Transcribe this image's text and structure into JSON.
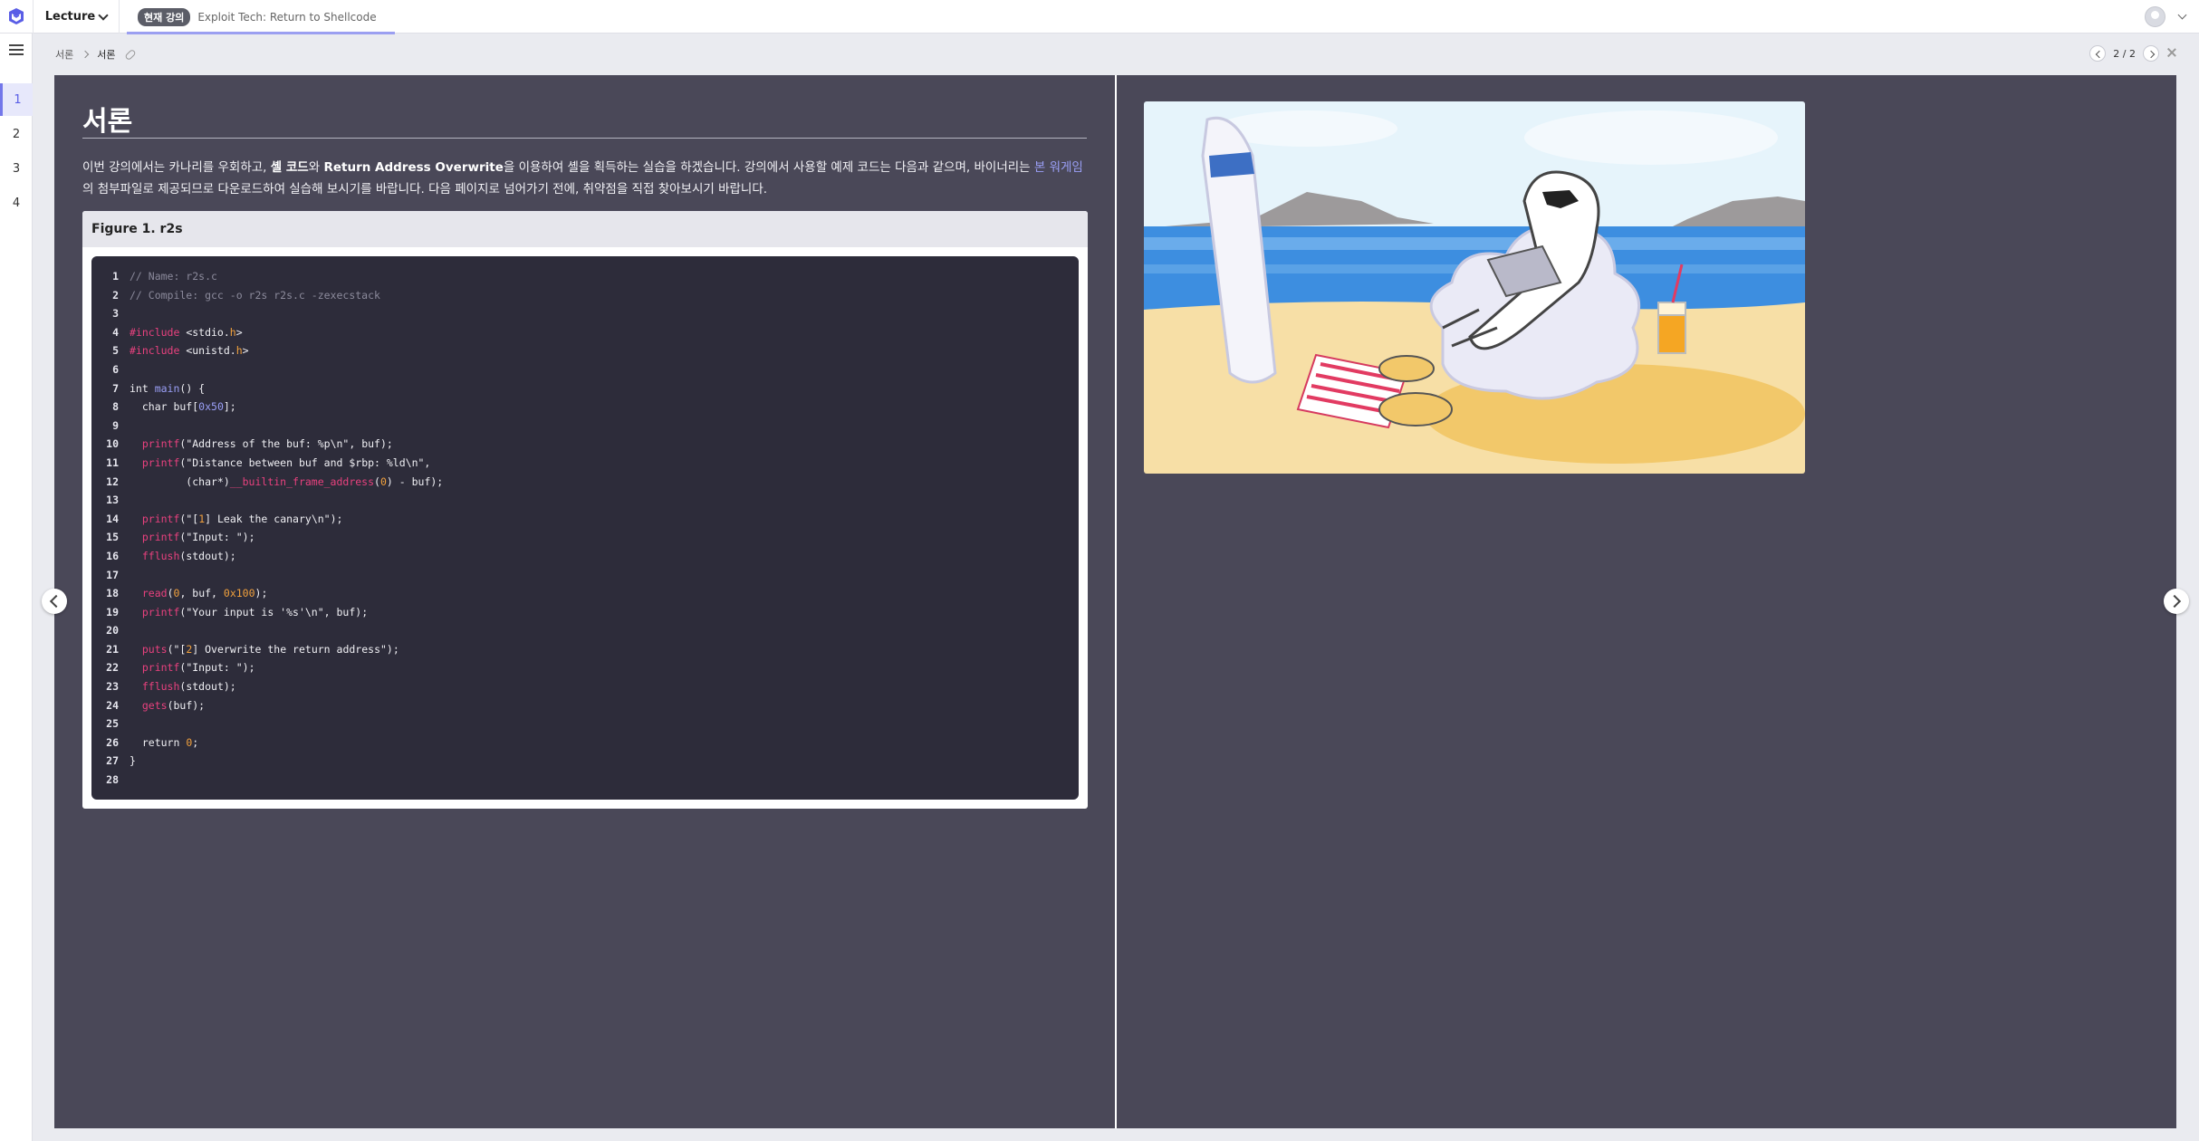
{
  "topbar": {
    "lecture_menu": "Lecture",
    "current_badge": "현재 강의",
    "current_title": "Exploit Tech: Return to Shellcode"
  },
  "sidebar": {
    "items": [
      "1",
      "2",
      "3",
      "4"
    ],
    "active_index": 0
  },
  "breadcrumb": {
    "parent": "서론",
    "current": "서론"
  },
  "pager": {
    "indicator": "2 / 2"
  },
  "slide": {
    "title": "서론",
    "intro": {
      "p1": "이번 강의에서는 카나리를 우회하고, ",
      "b1": "셸 코드",
      "p2": "와 ",
      "b2": "Return Address Overwrite",
      "p3": "을 이용하여 셸을 획득하는 실습을 하겠습니다. 강의에서 사용할 예제 코드는 다음과 같으며, 바이너리는 ",
      "link": "본 워게임",
      "p4": "의 첨부파일로 제공되므로 다운로드하여 실습해 보시기를 바랍니다. 다음 페이지로 넘어가기 전에, 취약점을 직접 찾아보시기 바랍니다."
    },
    "figure_caption": "Figure 1. r2s",
    "code_lines": [
      "// Name: r2s.c",
      "// Compile: gcc -o r2s r2s.c -zexecstack",
      "",
      "#include <stdio.h>",
      "#include <unistd.h>",
      "",
      "int main() {",
      "  char buf[0x50];",
      "",
      "  printf(\"Address of the buf: %p\\n\", buf);",
      "  printf(\"Distance between buf and $rbp: %ld\\n\",",
      "         (char*)__builtin_frame_address(0) - buf);",
      "",
      "  printf(\"[1] Leak the canary\\n\");",
      "  printf(\"Input: \");",
      "  fflush(stdout);",
      "",
      "  read(0, buf, 0x100);",
      "  printf(\"Your input is '%s'\\n\", buf);",
      "",
      "  puts(\"[2] Overwrite the return address\");",
      "  printf(\"Input: \");",
      "  fflush(stdout);",
      "  gets(buf);",
      "",
      "  return 0;",
      "}",
      ""
    ]
  },
  "colors": {
    "slide_bg": "#4a4858",
    "code_bg": "#2d2c3a",
    "accent": "#7377ea",
    "keyword_pink": "#e8417e",
    "number_orange": "#f2a13d",
    "comment_gray": "#8b8a9b"
  },
  "icons": {
    "logo": "dreamhack-logo",
    "menu": "hamburger-icon",
    "link": "link-icon",
    "close": "close-icon"
  }
}
